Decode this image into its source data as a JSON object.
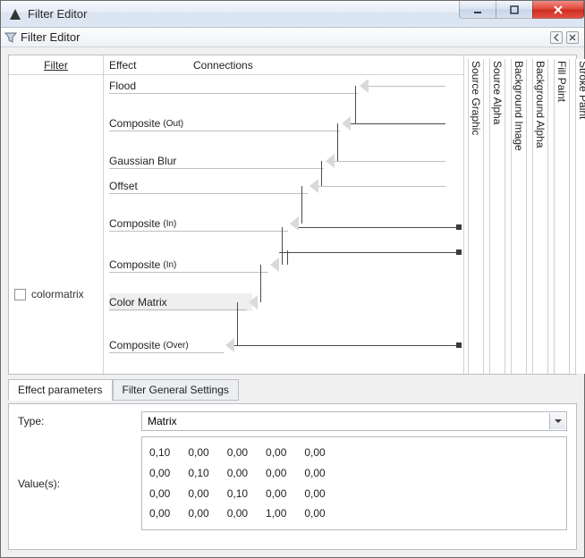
{
  "window": {
    "title": "Filter Editor"
  },
  "subheader": {
    "title": "Filter Editor"
  },
  "columns": {
    "filter": "Filter",
    "effect": "Effect",
    "connections": "Connections"
  },
  "filter_list": {
    "items": [
      {
        "name": "colormatrix",
        "checked": false
      }
    ]
  },
  "effects": [
    {
      "label": "Flood",
      "sub": ""
    },
    {
      "label": "Composite",
      "sub": "(Out)"
    },
    {
      "label": "Gaussian Blur",
      "sub": ""
    },
    {
      "label": "Offset",
      "sub": ""
    },
    {
      "label": "Composite",
      "sub": "(In)"
    },
    {
      "label": "Composite",
      "sub": "(In)"
    },
    {
      "label": "Color Matrix",
      "sub": "",
      "selected": true
    },
    {
      "label": "Composite",
      "sub": "(Over)"
    }
  ],
  "sources": [
    "Source Graphic",
    "Source Alpha",
    "Background Image",
    "Background Alpha",
    "Fill Paint",
    "Stroke Paint"
  ],
  "tabs": {
    "active": "Effect parameters",
    "items": [
      "Effect parameters",
      "Filter General Settings"
    ]
  },
  "params": {
    "type_label": "Type:",
    "type_value": "Matrix",
    "values_label": "Value(s):",
    "matrix": [
      [
        "0,10",
        "0,00",
        "0,00",
        "0,00",
        "0,00"
      ],
      [
        "0,00",
        "0,10",
        "0,00",
        "0,00",
        "0,00"
      ],
      [
        "0,00",
        "0,00",
        "0,10",
        "0,00",
        "0,00"
      ],
      [
        "0,00",
        "0,00",
        "0,00",
        "1,00",
        "0,00"
      ]
    ]
  },
  "chart_data": null
}
